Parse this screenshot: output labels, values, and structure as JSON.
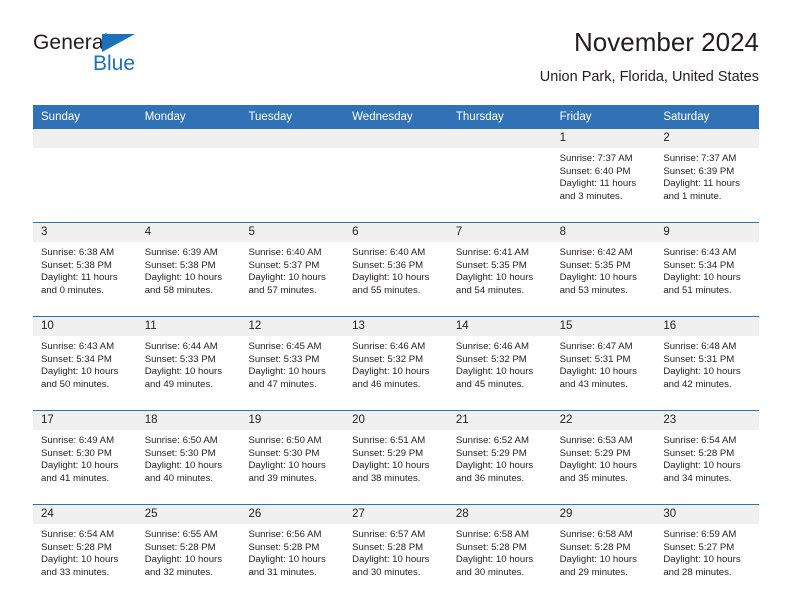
{
  "brand": {
    "name_top": "General",
    "name_bottom": "Blue",
    "triangle_color": "#1b72b8"
  },
  "header": {
    "month_title": "November 2024",
    "location": "Union Park, Florida, United States"
  },
  "theme": {
    "header_blue": "#3072b5",
    "day_band_gray": "#f0f0f0",
    "text_color": "#231f20"
  },
  "calendar": {
    "weekdays": [
      "Sunday",
      "Monday",
      "Tuesday",
      "Wednesday",
      "Thursday",
      "Friday",
      "Saturday"
    ],
    "weeks": [
      [
        {
          "day": "",
          "empty": true
        },
        {
          "day": "",
          "empty": true
        },
        {
          "day": "",
          "empty": true
        },
        {
          "day": "",
          "empty": true
        },
        {
          "day": "",
          "empty": true
        },
        {
          "day": "1",
          "sunrise": "Sunrise: 7:37 AM",
          "sunset": "Sunset: 6:40 PM",
          "daylight": "Daylight: 11 hours and 3 minutes."
        },
        {
          "day": "2",
          "sunrise": "Sunrise: 7:37 AM",
          "sunset": "Sunset: 6:39 PM",
          "daylight": "Daylight: 11 hours and 1 minute."
        }
      ],
      [
        {
          "day": "3",
          "sunrise": "Sunrise: 6:38 AM",
          "sunset": "Sunset: 5:38 PM",
          "daylight": "Daylight: 11 hours and 0 minutes."
        },
        {
          "day": "4",
          "sunrise": "Sunrise: 6:39 AM",
          "sunset": "Sunset: 5:38 PM",
          "daylight": "Daylight: 10 hours and 58 minutes."
        },
        {
          "day": "5",
          "sunrise": "Sunrise: 6:40 AM",
          "sunset": "Sunset: 5:37 PM",
          "daylight": "Daylight: 10 hours and 57 minutes."
        },
        {
          "day": "6",
          "sunrise": "Sunrise: 6:40 AM",
          "sunset": "Sunset: 5:36 PM",
          "daylight": "Daylight: 10 hours and 55 minutes."
        },
        {
          "day": "7",
          "sunrise": "Sunrise: 6:41 AM",
          "sunset": "Sunset: 5:35 PM",
          "daylight": "Daylight: 10 hours and 54 minutes."
        },
        {
          "day": "8",
          "sunrise": "Sunrise: 6:42 AM",
          "sunset": "Sunset: 5:35 PM",
          "daylight": "Daylight: 10 hours and 53 minutes."
        },
        {
          "day": "9",
          "sunrise": "Sunrise: 6:43 AM",
          "sunset": "Sunset: 5:34 PM",
          "daylight": "Daylight: 10 hours and 51 minutes."
        }
      ],
      [
        {
          "day": "10",
          "sunrise": "Sunrise: 6:43 AM",
          "sunset": "Sunset: 5:34 PM",
          "daylight": "Daylight: 10 hours and 50 minutes."
        },
        {
          "day": "11",
          "sunrise": "Sunrise: 6:44 AM",
          "sunset": "Sunset: 5:33 PM",
          "daylight": "Daylight: 10 hours and 49 minutes."
        },
        {
          "day": "12",
          "sunrise": "Sunrise: 6:45 AM",
          "sunset": "Sunset: 5:33 PM",
          "daylight": "Daylight: 10 hours and 47 minutes."
        },
        {
          "day": "13",
          "sunrise": "Sunrise: 6:46 AM",
          "sunset": "Sunset: 5:32 PM",
          "daylight": "Daylight: 10 hours and 46 minutes."
        },
        {
          "day": "14",
          "sunrise": "Sunrise: 6:46 AM",
          "sunset": "Sunset: 5:32 PM",
          "daylight": "Daylight: 10 hours and 45 minutes."
        },
        {
          "day": "15",
          "sunrise": "Sunrise: 6:47 AM",
          "sunset": "Sunset: 5:31 PM",
          "daylight": "Daylight: 10 hours and 43 minutes."
        },
        {
          "day": "16",
          "sunrise": "Sunrise: 6:48 AM",
          "sunset": "Sunset: 5:31 PM",
          "daylight": "Daylight: 10 hours and 42 minutes."
        }
      ],
      [
        {
          "day": "17",
          "sunrise": "Sunrise: 6:49 AM",
          "sunset": "Sunset: 5:30 PM",
          "daylight": "Daylight: 10 hours and 41 minutes."
        },
        {
          "day": "18",
          "sunrise": "Sunrise: 6:50 AM",
          "sunset": "Sunset: 5:30 PM",
          "daylight": "Daylight: 10 hours and 40 minutes."
        },
        {
          "day": "19",
          "sunrise": "Sunrise: 6:50 AM",
          "sunset": "Sunset: 5:30 PM",
          "daylight": "Daylight: 10 hours and 39 minutes."
        },
        {
          "day": "20",
          "sunrise": "Sunrise: 6:51 AM",
          "sunset": "Sunset: 5:29 PM",
          "daylight": "Daylight: 10 hours and 38 minutes."
        },
        {
          "day": "21",
          "sunrise": "Sunrise: 6:52 AM",
          "sunset": "Sunset: 5:29 PM",
          "daylight": "Daylight: 10 hours and 36 minutes."
        },
        {
          "day": "22",
          "sunrise": "Sunrise: 6:53 AM",
          "sunset": "Sunset: 5:29 PM",
          "daylight": "Daylight: 10 hours and 35 minutes."
        },
        {
          "day": "23",
          "sunrise": "Sunrise: 6:54 AM",
          "sunset": "Sunset: 5:28 PM",
          "daylight": "Daylight: 10 hours and 34 minutes."
        }
      ],
      [
        {
          "day": "24",
          "sunrise": "Sunrise: 6:54 AM",
          "sunset": "Sunset: 5:28 PM",
          "daylight": "Daylight: 10 hours and 33 minutes."
        },
        {
          "day": "25",
          "sunrise": "Sunrise: 6:55 AM",
          "sunset": "Sunset: 5:28 PM",
          "daylight": "Daylight: 10 hours and 32 minutes."
        },
        {
          "day": "26",
          "sunrise": "Sunrise: 6:56 AM",
          "sunset": "Sunset: 5:28 PM",
          "daylight": "Daylight: 10 hours and 31 minutes."
        },
        {
          "day": "27",
          "sunrise": "Sunrise: 6:57 AM",
          "sunset": "Sunset: 5:28 PM",
          "daylight": "Daylight: 10 hours and 30 minutes."
        },
        {
          "day": "28",
          "sunrise": "Sunrise: 6:58 AM",
          "sunset": "Sunset: 5:28 PM",
          "daylight": "Daylight: 10 hours and 30 minutes."
        },
        {
          "day": "29",
          "sunrise": "Sunrise: 6:58 AM",
          "sunset": "Sunset: 5:28 PM",
          "daylight": "Daylight: 10 hours and 29 minutes."
        },
        {
          "day": "30",
          "sunrise": "Sunrise: 6:59 AM",
          "sunset": "Sunset: 5:27 PM",
          "daylight": "Daylight: 10 hours and 28 minutes."
        }
      ]
    ]
  }
}
